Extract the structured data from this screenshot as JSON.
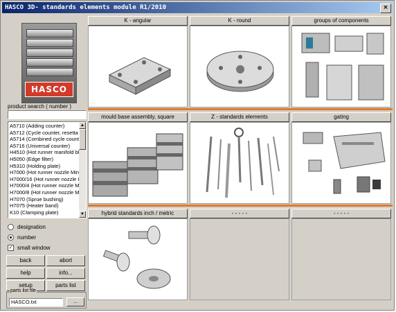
{
  "window": {
    "title": "HASCO 3D- standards elements module R1/2010",
    "close_label": "×"
  },
  "logo": {
    "brand": "HASCO"
  },
  "search": {
    "label": "product search ( number )",
    "value": ""
  },
  "list": [
    "A5710 (Adding counter)",
    "A5712 (Cycle counter, resetta",
    "A5714 (Combined cycle count",
    "A5716 (Universal counter)",
    "H4510 (Hot runner manifold bl",
    "H5050 (Edge filter)",
    "H5310 (Holding plate)",
    "H7000 (Hot runner nozzle Min",
    "H7000/16 (Hot runner nozzle I",
    "H7000/4 (Hot runner nozzle M",
    "H7000/8 (Hot runner nozzle M",
    "H7070 (Sprue bushing)",
    "H7075 (Heater band)",
    "K10 (Clamping plate)"
  ],
  "options": {
    "designation_label": "designation",
    "number_label": "number",
    "small_window_label": "small window",
    "selected": "number",
    "small_window_checked": true
  },
  "buttons": {
    "back": "back",
    "abort": "abort",
    "help": "help",
    "info": "info...",
    "setup": "setup",
    "parts_list": "parts list"
  },
  "parts_file": {
    "legend": "parts list file",
    "value": "HASCO.txt",
    "browse_label": "..."
  },
  "tiles": [
    {
      "label": "K - angular"
    },
    {
      "label": "K - round"
    },
    {
      "label": "groups of components"
    },
    {
      "label": "mould base assembly, square"
    },
    {
      "label": "Z - standards elements"
    },
    {
      "label": "gating"
    },
    {
      "label": "hybrid standards inch / metric"
    },
    {
      "label": "- - - - -"
    },
    {
      "label": "- - - - -"
    }
  ],
  "colors": {
    "separator": "#e07a2a",
    "brand_red": "#d23a2a",
    "title_blue": "#0a246a"
  },
  "icons": {
    "close": "close-icon",
    "scroll_up": "arrow-up-icon",
    "scroll_down": "arrow-down-icon"
  }
}
